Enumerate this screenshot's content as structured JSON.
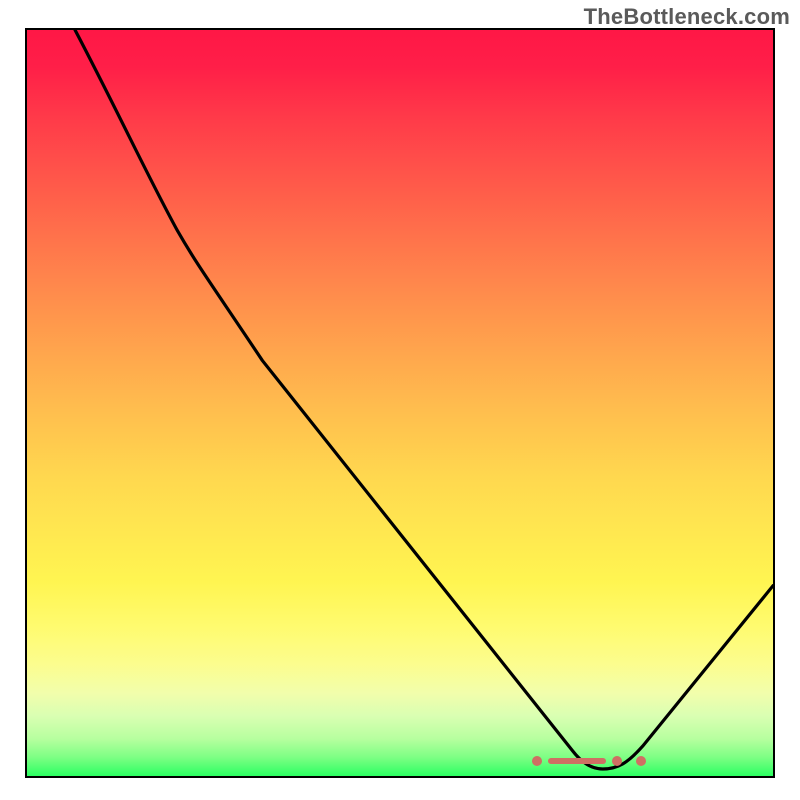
{
  "watermark": "TheBottleneck.com",
  "colors": {
    "curve": "#000000",
    "marker": "#cf6f63",
    "gradient_top": "#ff1746",
    "gradient_mid": "#ffd84f",
    "gradient_bottom": "#2cff62",
    "border": "#000000"
  },
  "chart_data": {
    "type": "line",
    "title": "",
    "xlabel": "",
    "ylabel": "",
    "xlim": [
      0,
      100
    ],
    "ylim": [
      0,
      100
    ],
    "grid": false,
    "legend": false,
    "background": "red-yellow-green vertical gradient (low = green = good, high = red = bad)",
    "series": [
      {
        "name": "bottleneck-curve",
        "comment": "Approximate values read from pixel positions; y is bottleneck severity (100=worst red, 0=best green). Curve starts at top-left, bends, descends to a minimum near x≈78, then rises toward the right edge.",
        "x": [
          6,
          12,
          18,
          22,
          28,
          35,
          45,
          55,
          65,
          73,
          77,
          80,
          85,
          92,
          100
        ],
        "y": [
          100,
          90,
          78,
          72,
          60,
          50,
          38,
          28,
          18,
          10,
          3,
          2,
          6,
          15,
          26
        ],
        "minimum_x": 78,
        "minimum_y": 2
      }
    ],
    "markers": {
      "comment": "Red marker cluster highlighting the optimum (trough) region along the bottom",
      "x_range": [
        70,
        83
      ],
      "y": 2,
      "color": "#cf6f63"
    }
  }
}
